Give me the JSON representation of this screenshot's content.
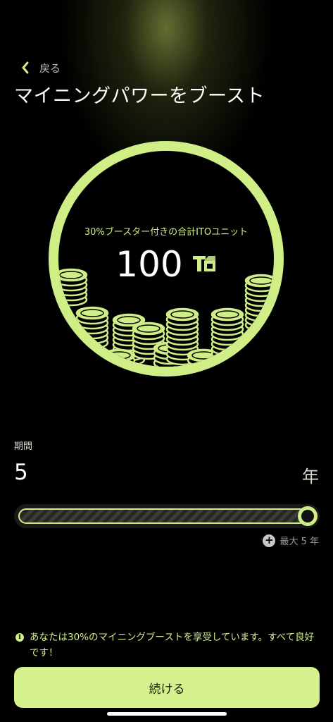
{
  "header": {
    "back_label": "戻る",
    "title": "マイニングパワーをブースト"
  },
  "summary": {
    "caption": "30%ブースター付きの合計ITOユニット",
    "value": "100"
  },
  "period": {
    "label": "期間",
    "value": "5",
    "unit": "年",
    "slider_fraction": 1.0,
    "max_label": "最大 5 年"
  },
  "notice": {
    "text": "あなたは30%のマイニングブーストを享受しています。すべて良好です！"
  },
  "actions": {
    "continue_label": "続ける"
  },
  "colors": {
    "accent": "#cfee86",
    "background": "#000000",
    "button": "#d6f08e"
  }
}
